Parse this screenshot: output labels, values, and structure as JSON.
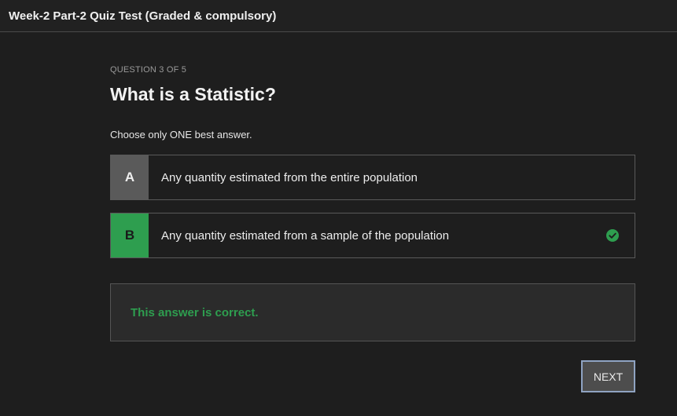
{
  "header": {
    "title": "Week-2 Part-2 Quiz Test (Graded & compulsory)"
  },
  "quiz": {
    "counter": "QUESTION 3 OF 5",
    "question": "What is a Statistic?",
    "instruction": "Choose only ONE best answer.",
    "options": [
      {
        "letter": "A",
        "text": "Any quantity estimated from the entire population",
        "selected": false
      },
      {
        "letter": "B",
        "text": "Any quantity estimated from a sample of the population",
        "selected": true,
        "status_icon": "check-circle-icon"
      }
    ],
    "feedback": "This answer is correct.",
    "next_label": "NEXT"
  },
  "colors": {
    "background": "#1e1e1e",
    "correct": "#2e9e4f",
    "option_a_letter_bg": "#5a5a5a",
    "feedback_bg": "#2b2b2b",
    "next_border": "#8fa3c2"
  }
}
